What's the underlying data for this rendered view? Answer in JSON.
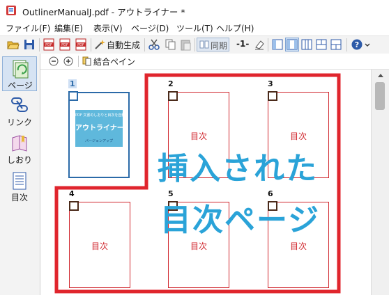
{
  "window": {
    "title": "OutlinerManualJ.pdf - アウトライナー *"
  },
  "menu": [
    "ファイル(F)",
    "編集(E)",
    "表示(V)",
    "ページ(D)",
    "ツール(T)",
    "ヘルプ(H)"
  ],
  "toolbar": {
    "auto_generate": "自動生成",
    "sync": "同期",
    "page_indicator": "-1-"
  },
  "subbar": {
    "combine_pane": "結合ペイン"
  },
  "sidebar": [
    {
      "label": "ページ",
      "icon": "page-icon",
      "active": true
    },
    {
      "label": "リンク",
      "icon": "link-icon"
    },
    {
      "label": "しおり",
      "icon": "bookmark-icon"
    },
    {
      "label": "目次",
      "icon": "toc-icon"
    }
  ],
  "pages": [
    {
      "number": "1",
      "content": "cover"
    },
    {
      "number": "2",
      "content": "目次"
    },
    {
      "number": "3",
      "content": "目次"
    },
    {
      "number": "4",
      "content": "目次"
    },
    {
      "number": "5",
      "content": "目次"
    },
    {
      "number": "6",
      "content": "目次"
    }
  ],
  "cover": {
    "top_text": "PDF 文書のしおりと目次を自動作成",
    "title": "アウトライナー3",
    "subtitle": "バージョンアップ"
  },
  "annotation": {
    "line1": "挿入された",
    "line2": "目次ページ"
  },
  "colors": {
    "annotation": "#2aa3d8",
    "highlight_border": "#e0252d",
    "page_border": "#d0262d",
    "selected_page": "#2b6aa8"
  }
}
